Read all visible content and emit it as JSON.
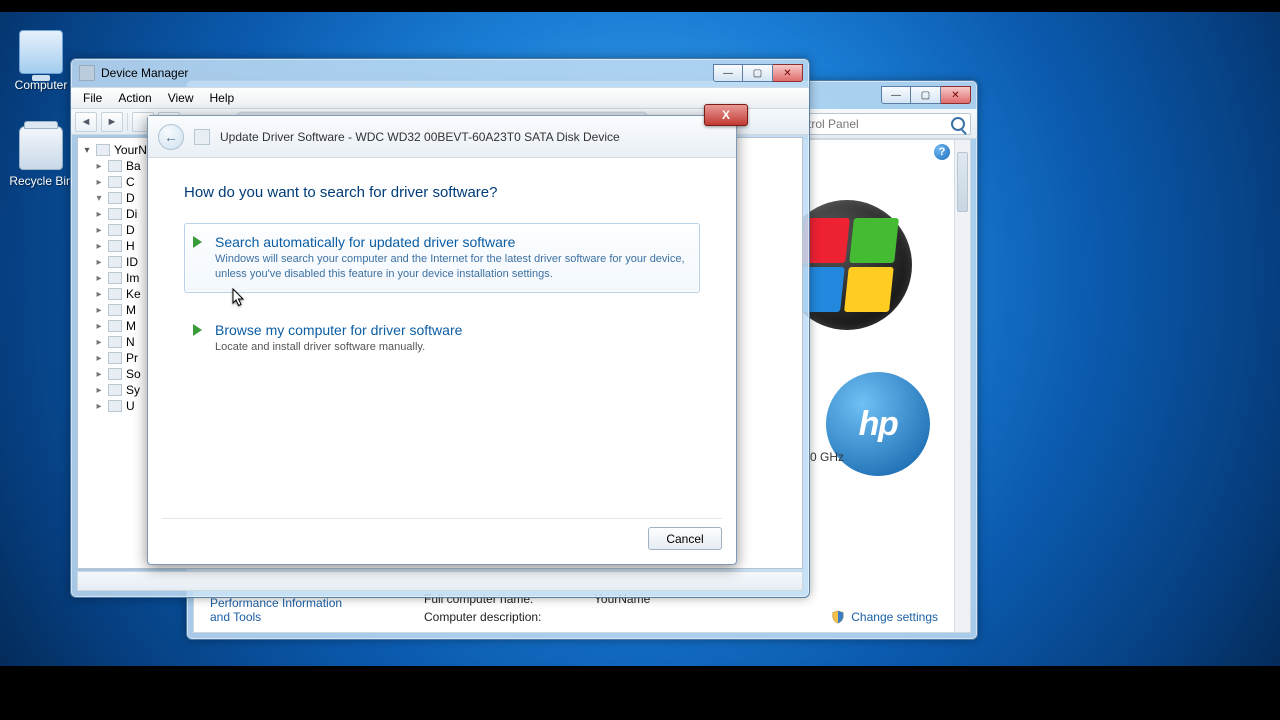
{
  "desktop_icons": {
    "computer": "Computer",
    "recycle_bin": "Recycle Bin"
  },
  "device_manager": {
    "title": "Device Manager",
    "menu": {
      "file": "File",
      "action": "Action",
      "view": "View",
      "help": "Help"
    },
    "tree_root": "YourName",
    "tree_items": [
      "Ba",
      "C",
      "D",
      "Di",
      "D",
      "H",
      "ID",
      "Im",
      "Ke",
      "M",
      "M",
      "N",
      "Pr",
      "So",
      "Sy",
      "U"
    ]
  },
  "wizard": {
    "title": "Update Driver Software - WDC WD32 00BEVT-60A23T0 SATA Disk Device",
    "heading": "How do you want to search for driver software?",
    "opt1_title": "Search automatically for updated driver software",
    "opt1_desc": "Windows will search your computer and the Internet for the latest driver software for your device, unless you've disabled this feature in your device installation settings.",
    "opt2_title": "Browse my computer for driver software",
    "opt2_desc": "Locate and install driver software manually.",
    "cancel": "Cancel",
    "close_x": "X"
  },
  "system_window": {
    "search_placeholder": "trol Panel",
    "ghz_fragment": "0 GHz",
    "change_settings": "Change settings",
    "sidebar_link": "Performance Information and Tools",
    "full_name_label": "Full computer name:",
    "full_name_value": "YourName",
    "desc_label": "Computer description:",
    "hp_text": "hp",
    "help_q": "?"
  },
  "caption_glyphs": {
    "min": "—",
    "max": "▢",
    "close": "✕",
    "back": "←",
    "tri_right": "▸",
    "tri_down": "▾"
  }
}
